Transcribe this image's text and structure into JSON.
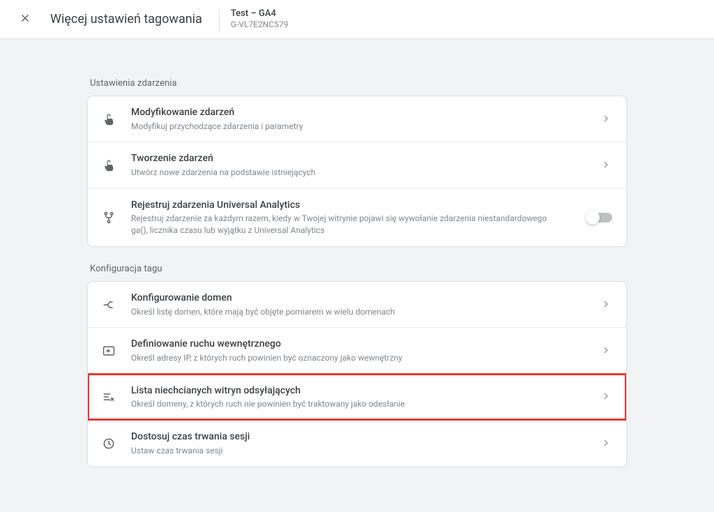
{
  "header": {
    "title": "Więcej ustawień tagowania",
    "property_name": "Test – GA4",
    "property_id": "G-VL7E2NC579"
  },
  "sections": {
    "events": {
      "title": "Ustawienia zdarzenia",
      "items": [
        {
          "title": "Modyfikowanie zdarzeń",
          "desc": "Modyfikuj przychodzące zdarzenia i parametry"
        },
        {
          "title": "Tworzenie zdarzeń",
          "desc": "Utwórz nowe zdarzenia na podstawie istniejących"
        },
        {
          "title": "Rejestruj zdarzenia Universal Analytics",
          "desc": "Rejestruj zdarzenie za każdym razem, kiedy w Twojej witrynie pojawi się wywołanie zdarzenia niestandardowego ga(), licznika czasu lub wyjątku z Universal Analytics"
        }
      ]
    },
    "tag": {
      "title": "Konfiguracja tagu",
      "items": [
        {
          "title": "Konfigurowanie domen",
          "desc": "Określ listę domen, które mają być objęte pomiarem w wielu domenach"
        },
        {
          "title": "Definiowanie ruchu wewnętrznego",
          "desc": "Określ adresy IP, z których ruch powinien być oznaczony jako wewnętrzny"
        },
        {
          "title": "Lista niechcianych witryn odsyłających",
          "desc": "Określ domeny, z których ruch nie powinien być traktowany jako odesłanie"
        },
        {
          "title": "Dostosuj czas trwania sesji",
          "desc": "Ustaw czas trwania sesji"
        }
      ]
    }
  }
}
